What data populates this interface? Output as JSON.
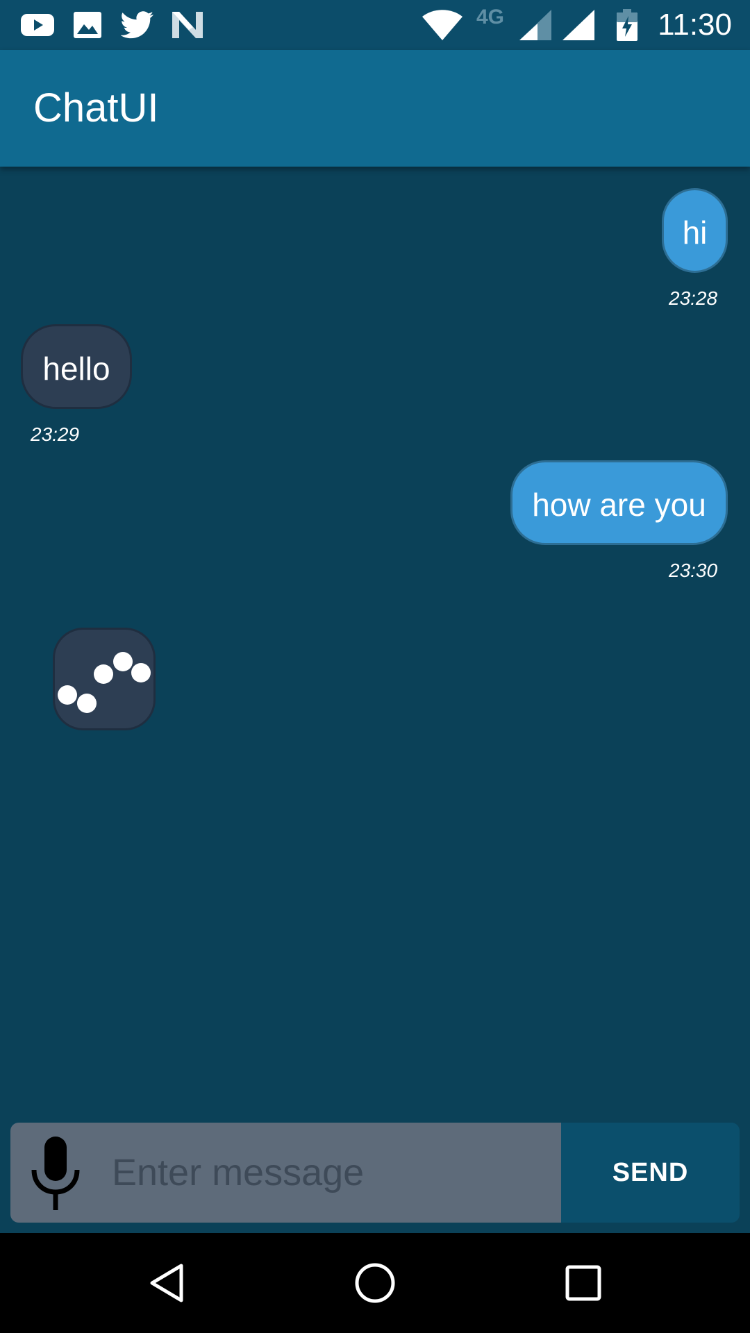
{
  "status_bar": {
    "network": "4G",
    "time": "11:30",
    "notification_icons": [
      "youtube-icon",
      "image-icon",
      "twitter-icon",
      "n-app-icon"
    ],
    "system_icons": [
      "wifi-icon",
      "cellular-signal-icon",
      "cellular-signal-icon",
      "battery-charging-icon"
    ]
  },
  "app_bar": {
    "title": "ChatUI"
  },
  "messages": [
    {
      "direction": "outgoing",
      "text": "hi",
      "time": "23:28"
    },
    {
      "direction": "incoming",
      "text": "hello",
      "time": "23:29"
    },
    {
      "direction": "outgoing",
      "text": "how are you",
      "time": "23:30"
    }
  ],
  "typing_indicator": {
    "icon": "typing-dots-icon"
  },
  "composer": {
    "mic_icon": "microphone-icon",
    "placeholder": "Enter message",
    "value": "",
    "send_label": "SEND"
  },
  "nav_bar": {
    "buttons": [
      "back-icon",
      "home-icon",
      "recents-icon"
    ]
  },
  "colors": {
    "status_bar": "#0c4d6a",
    "app_bar": "#106a90",
    "background": "#0b4158",
    "outgoing_bubble": "#3a9ad9",
    "incoming_bubble": "#2d3e53",
    "input_field": "#5e6b7a"
  }
}
